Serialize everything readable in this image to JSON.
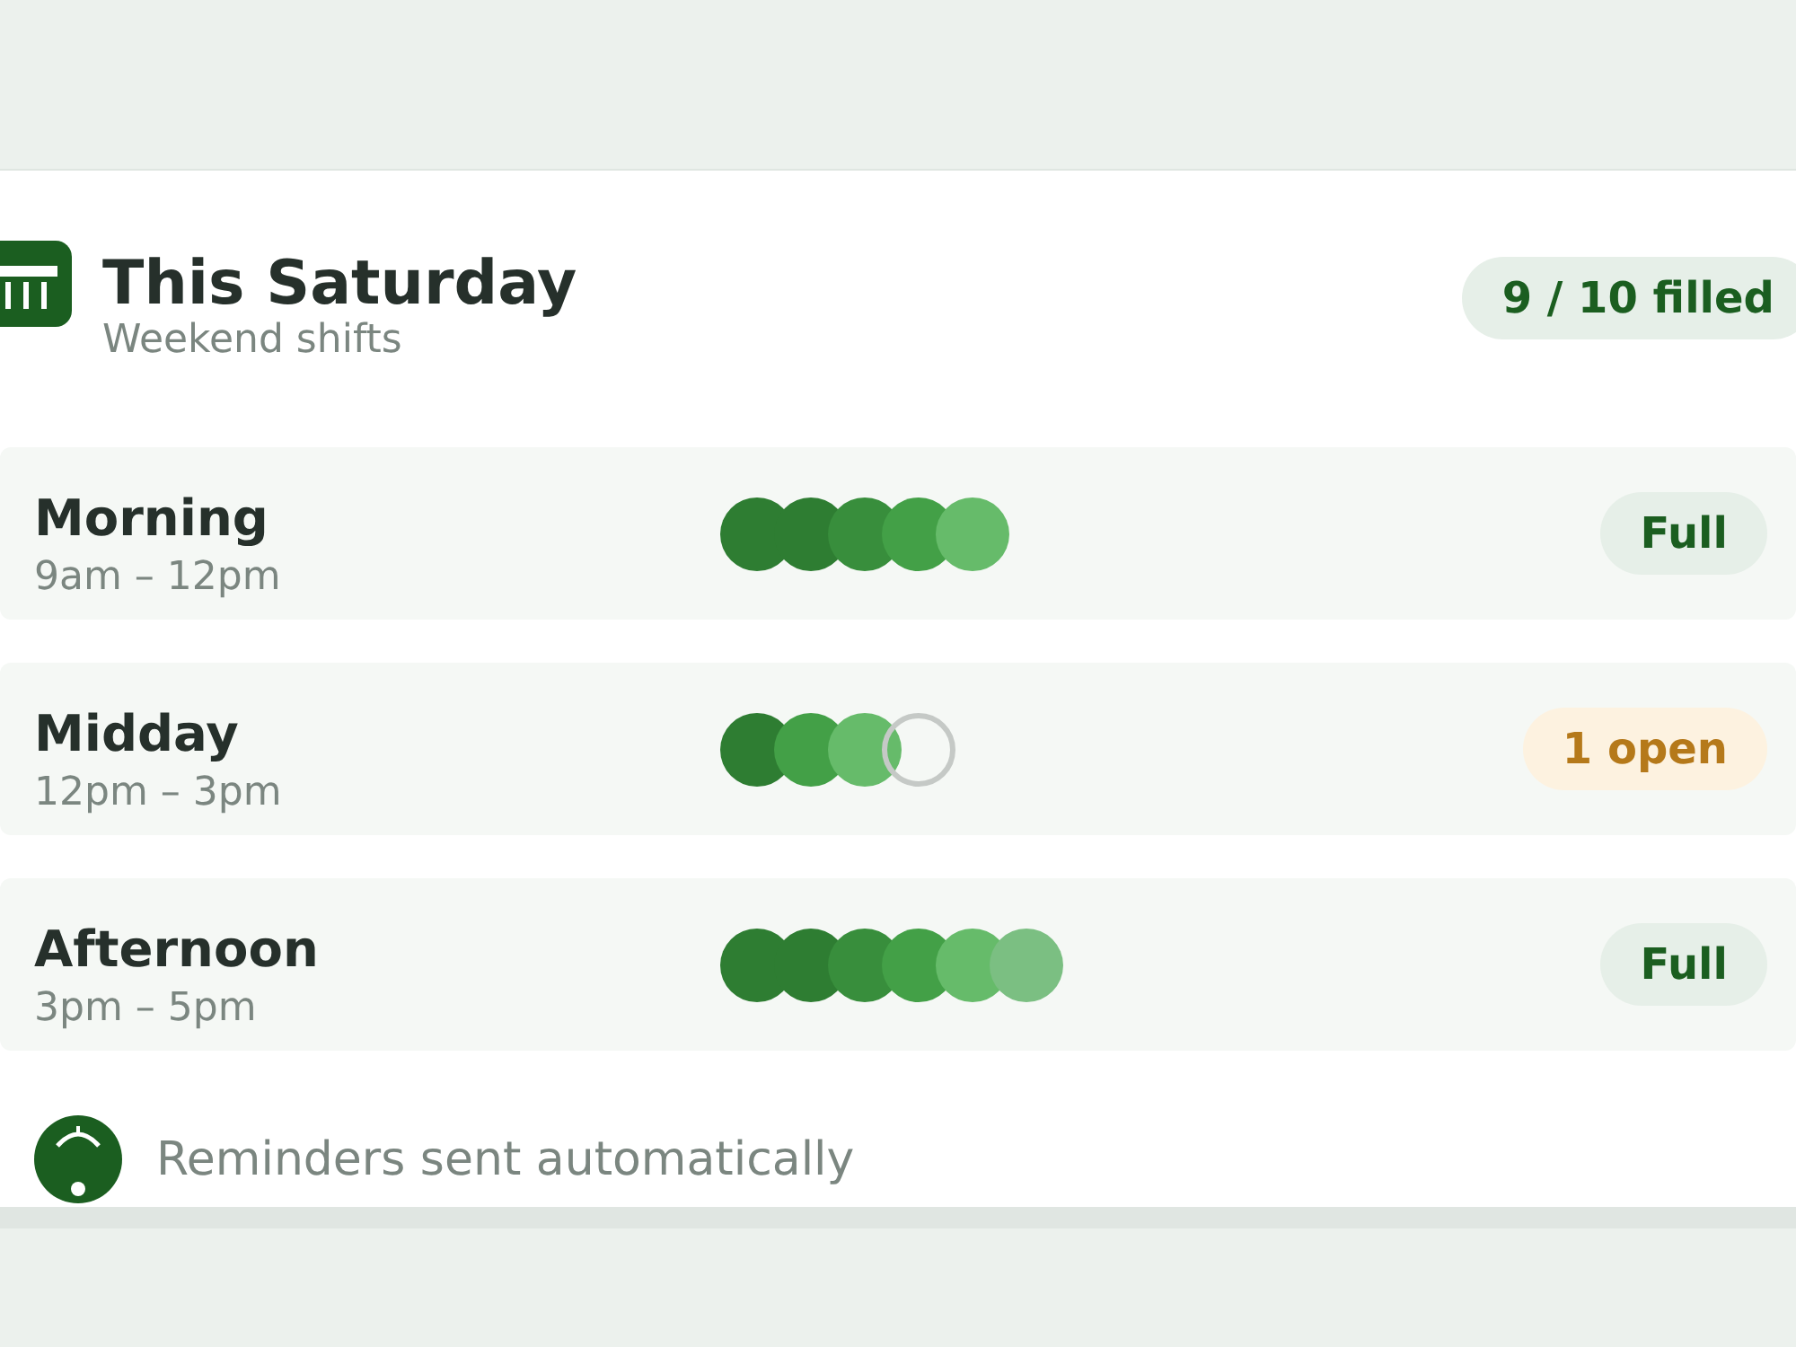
{
  "header": {
    "title": "This Saturday",
    "subtitle": "Weekend shifts",
    "badge": "9 / 10 filled"
  },
  "shifts": [
    {
      "name": "Morning",
      "time": "9am – 12pm",
      "slots": [
        {
          "filled": true,
          "color": "#2e7d32"
        },
        {
          "filled": true,
          "color": "#2e7d32"
        },
        {
          "filled": true,
          "color": "#388e3c"
        },
        {
          "filled": true,
          "color": "#43a047"
        },
        {
          "filled": true,
          "color": "#66bb6a"
        }
      ],
      "status": {
        "kind": "full",
        "label": "Full"
      }
    },
    {
      "name": "Midday",
      "time": "12pm – 3pm",
      "slots": [
        {
          "filled": true,
          "color": "#2e7d32"
        },
        {
          "filled": true,
          "color": "#43a047"
        },
        {
          "filled": true,
          "color": "#66bb6a"
        },
        {
          "filled": false
        }
      ],
      "status": {
        "kind": "open",
        "label": "1 open"
      }
    },
    {
      "name": "Afternoon",
      "time": "3pm – 5pm",
      "slots": [
        {
          "filled": true,
          "color": "#2e7d32"
        },
        {
          "filled": true,
          "color": "#2e7d32"
        },
        {
          "filled": true,
          "color": "#388e3c"
        },
        {
          "filled": true,
          "color": "#43a047"
        },
        {
          "filled": true,
          "color": "#66bb6a"
        },
        {
          "filled": true,
          "color": "#7bbf82"
        }
      ],
      "status": {
        "kind": "full",
        "label": "Full"
      }
    }
  ],
  "footer": {
    "text": "Reminders sent automatically"
  }
}
